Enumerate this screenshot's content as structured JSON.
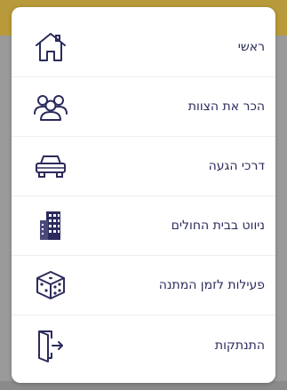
{
  "menu": {
    "items": [
      {
        "label": "ראשי",
        "icon": "home-icon"
      },
      {
        "label": "הכר את הצוות",
        "icon": "team-icon"
      },
      {
        "label": "דרכי הגעה",
        "icon": "car-icon"
      },
      {
        "label": "ניווט בבית החולים",
        "icon": "building-icon"
      },
      {
        "label": "פעילות לזמן המתנה",
        "icon": "dice-icon"
      },
      {
        "label": "התנתקות",
        "icon": "logout-door-icon"
      }
    ]
  },
  "colors": {
    "icon_stroke": "#2b2b5c",
    "label_text": "#2b2b5c",
    "menu_background": "#ffffff",
    "overlay": "#8f8f8f"
  }
}
